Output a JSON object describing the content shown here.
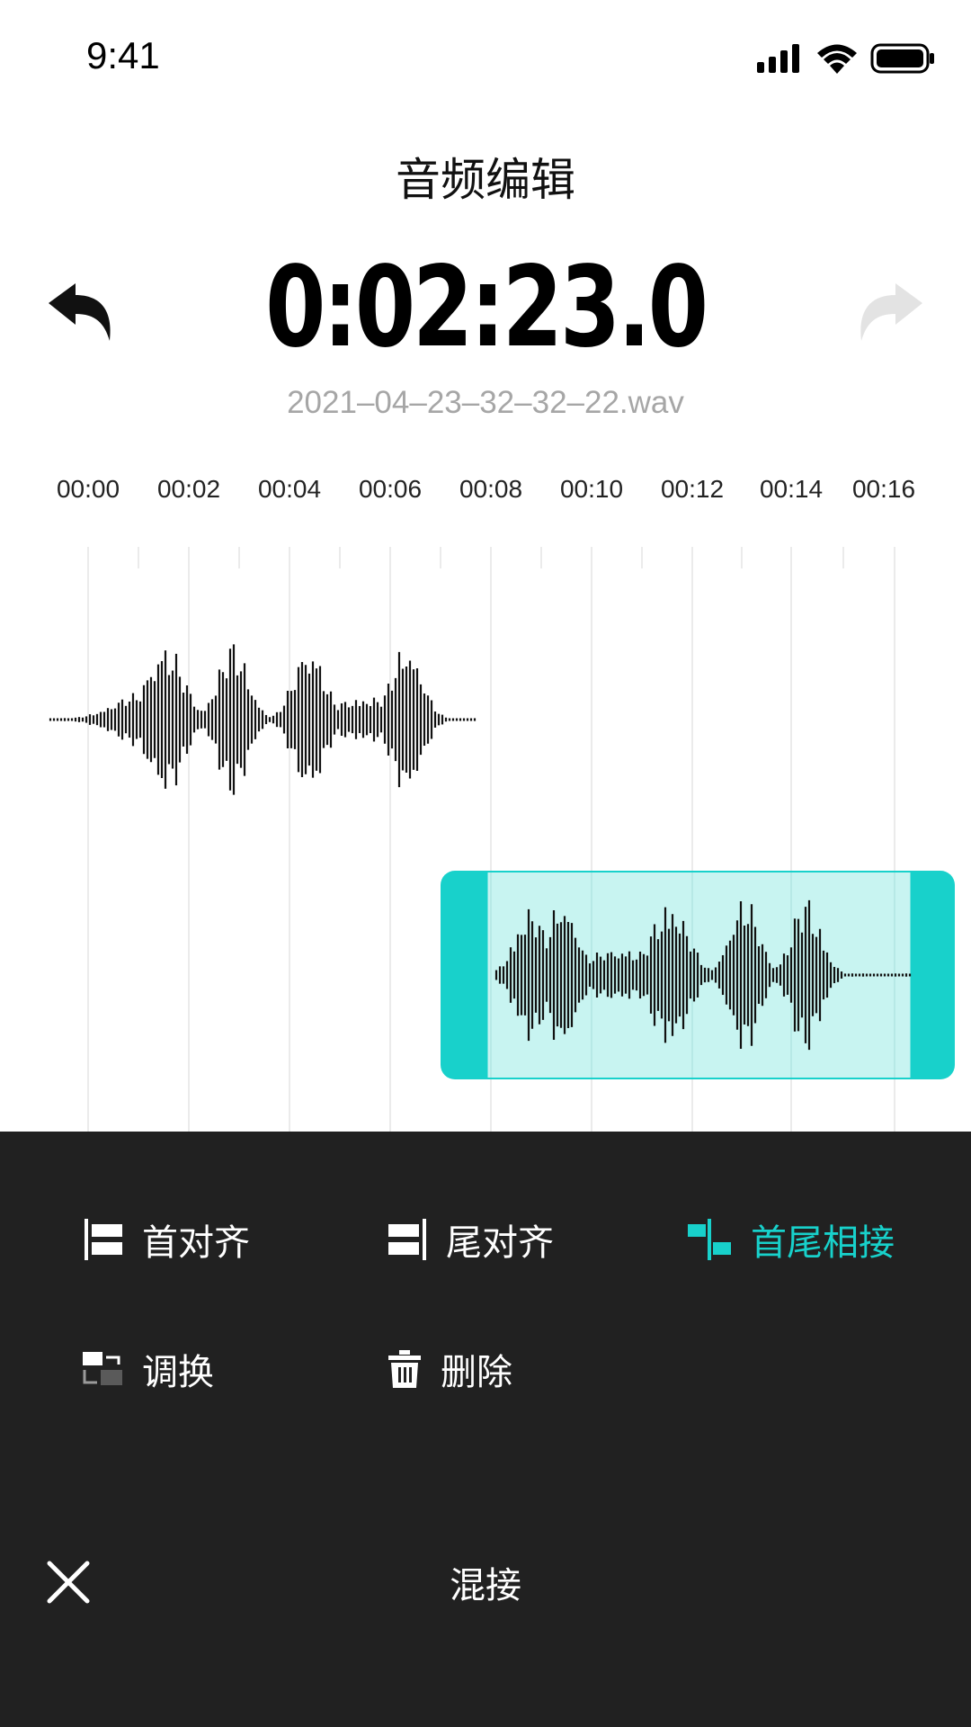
{
  "status_bar": {
    "time": "9:41"
  },
  "header": {
    "title": "音频编辑"
  },
  "timer": {
    "value": "0:02:23.0",
    "filename": "2021–04–23–32–32–22.wav"
  },
  "ruler": {
    "labels": [
      "00:00",
      "00:02",
      "00:04",
      "00:06",
      "00:08",
      "00:10",
      "00:12",
      "00:14",
      "00:16"
    ]
  },
  "colors": {
    "accent": "#18d1cb",
    "selection_fill": "#c8f4f1",
    "sheet_bg": "#212121",
    "disabled": "#e0e0e0"
  },
  "actions": {
    "align_start": "首对齐",
    "align_end": "尾对齐",
    "join": "首尾相接",
    "swap": "调换",
    "delete": "删除"
  },
  "footer": {
    "title": "混接"
  },
  "icons": [
    "undo-icon",
    "redo-icon",
    "close-icon",
    "align-start-icon",
    "align-end-icon",
    "join-icon",
    "swap-icon",
    "trash-icon",
    "signal-icon",
    "wifi-icon",
    "battery-icon"
  ]
}
